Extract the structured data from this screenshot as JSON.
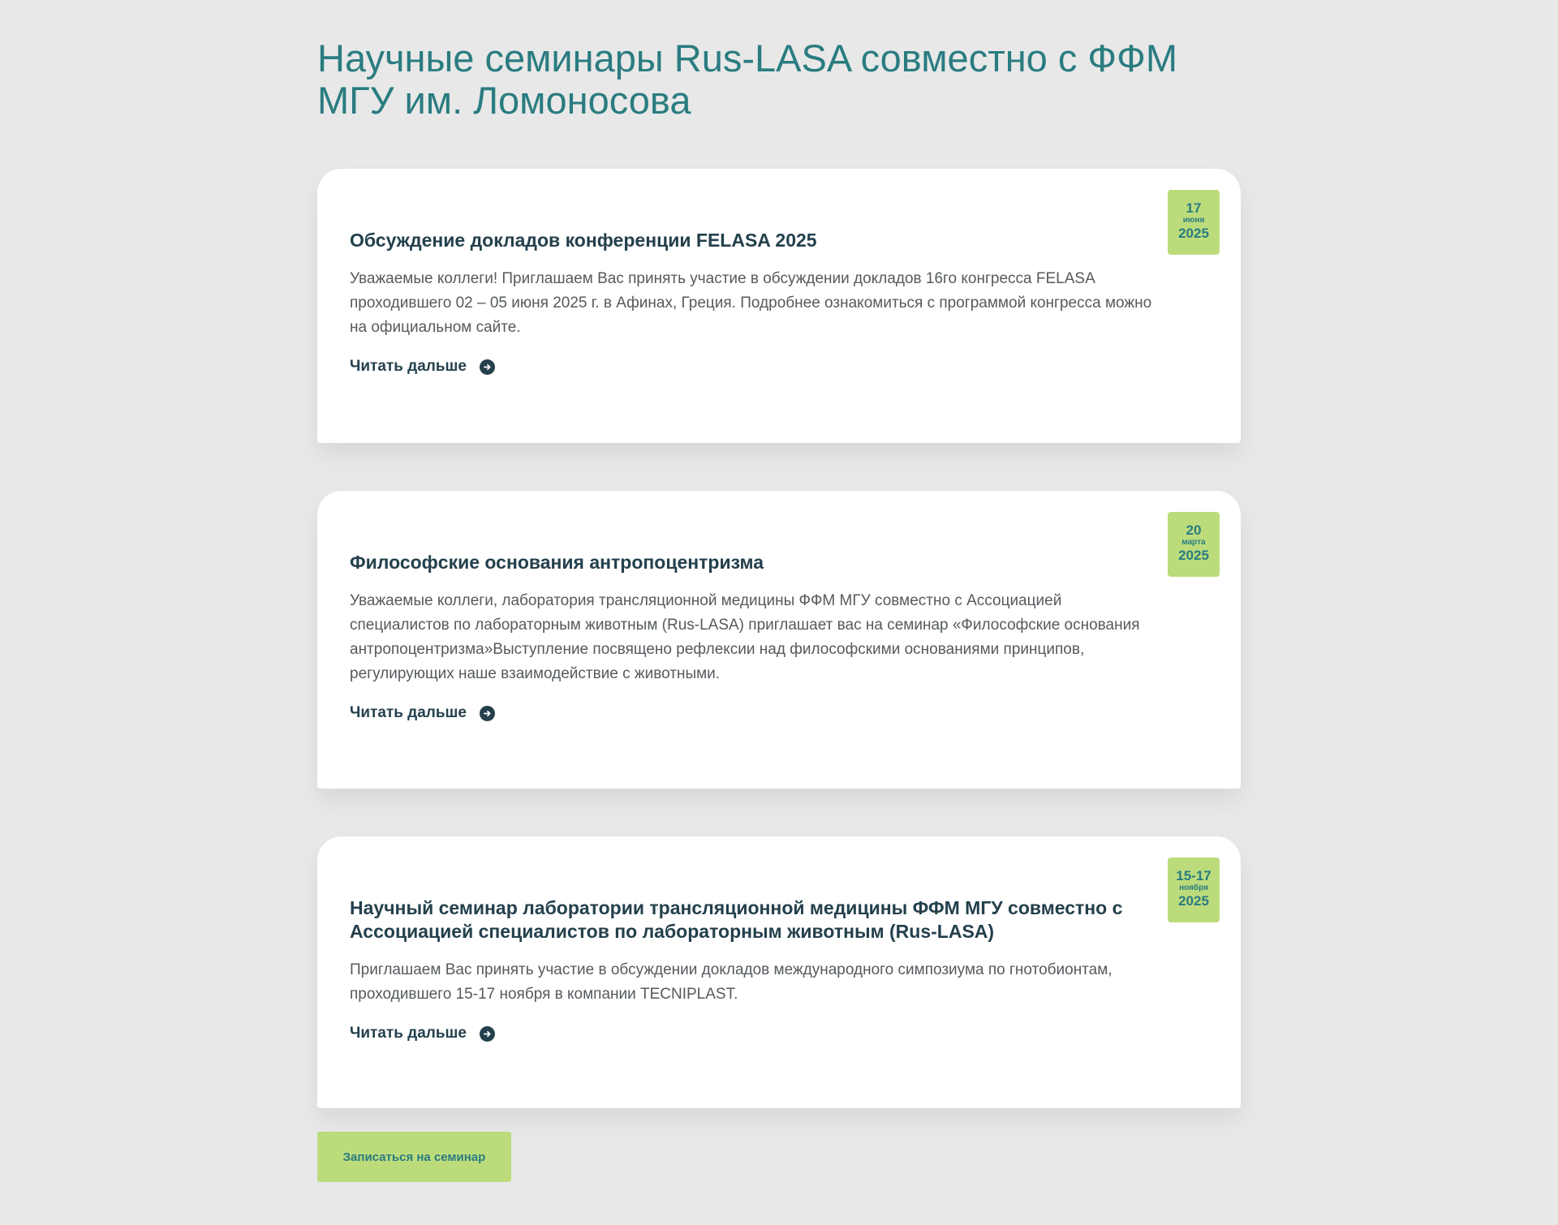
{
  "page": {
    "title": "Научные семинары Rus-LASA совместно с ФФМ МГУ им. Ломоносова"
  },
  "seminars": [
    {
      "date": {
        "day": "17",
        "month": "июня",
        "year": "2025"
      },
      "title": "Обсуждение докладов конференции FELASA 2025",
      "text": "Уважаемые коллеги! Приглашаем Вас принять участие в обсуждении докладов 16го конгресса FELASA проходившего 02 – 05 июня 2025 г. в Афинах, Греция. Подробнее ознакомиться с программой конгресса можно на официальном сайте.",
      "read_more": "Читать дальше"
    },
    {
      "date": {
        "day": "20",
        "month": "марта",
        "year": "2025"
      },
      "title": "Философские основания антропоцентризма",
      "text": "Уважаемые коллеги, лаборатория трансляционной медицины ФФМ МГУ совместно с Ассоциацией специалистов по лабораторным животным (Rus-LASA) приглашает вас на семинар «Философские основания антропоцентризма»Выступление посвящено рефлексии над философскими основаниями принципов, регулирующих наше взаимодействие с животными.",
      "read_more": "Читать дальше"
    },
    {
      "date": {
        "day": "15-17",
        "month": "ноября",
        "year": "2025"
      },
      "title": "Научный семинар лаборатории трансляционной медицины ФФМ МГУ совместно с Ассоциацией специалистов по лабораторным животным (Rus-LASA)",
      "text": "Приглашаем Вас принять участие в обсуждении докладов международного симпозиума по гнотобионтам, проходившего 15-17 ноября в компании TECNIPLAST.",
      "read_more": "Читать дальше"
    }
  ],
  "signup": {
    "label": "Записаться на семинар"
  },
  "icons": {
    "read_more_arrow": "arrow-right-circle-icon"
  },
  "colors": {
    "background": "#e8e8e8",
    "title": "#2a7c80",
    "card_title": "#24404d",
    "badge": "#bcdc7c",
    "body_text": "#555a5e"
  }
}
